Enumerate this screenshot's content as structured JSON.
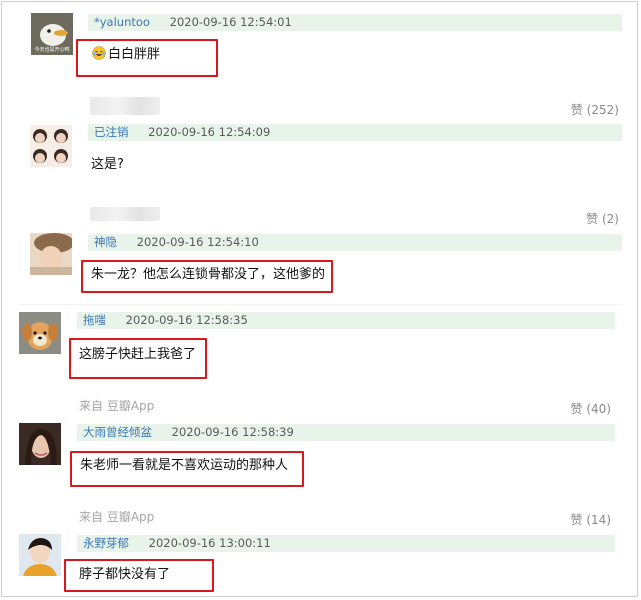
{
  "comments": [
    {
      "user": "*yaluntoo",
      "time": "2020-09-16 12:54:01",
      "text": "白白胖胖",
      "emoji": "laughing-tears-icon"
    },
    {
      "user": "已注销",
      "time": "2020-09-16 12:54:09",
      "text": "这是?",
      "vote": "赞 (252)"
    },
    {
      "user": "神隐",
      "time": "2020-09-16 12:54:10",
      "text": "朱一龙？他怎么连锁骨都没了，这他爹的",
      "vote": "赞 (2)"
    },
    {
      "user": "拖嗤",
      "time": "2020-09-16 12:58:35",
      "text": "这膀子快赶上我爸了"
    },
    {
      "user": "大雨曾经倾盆",
      "time": "2020-09-16 12:58:39",
      "text": "朱老师一看就是不喜欢运动的那种人",
      "source": "来自 豆瓣App",
      "vote": "赞 (40)"
    },
    {
      "user": "永野芽郁",
      "time": "2020-09-16 13:00:11",
      "text": "脖子都快没有了",
      "source": "来自 豆瓣App",
      "vote": "赞 (14)"
    }
  ],
  "avatar_texts": {
    "duck": "今天也是开心鸭"
  },
  "colors": {
    "highlight": "#d9171d",
    "header_bg": "#e8f3ea",
    "username": "#3c78b4"
  }
}
